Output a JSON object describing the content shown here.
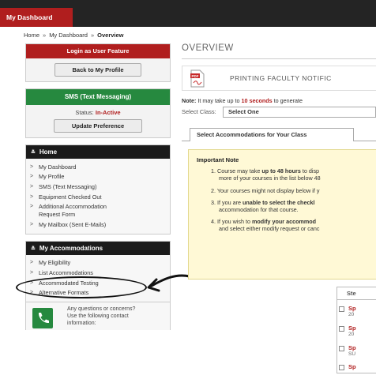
{
  "topbar": {
    "tab_label": "My Dashboard"
  },
  "breadcrumb": [
    "Home",
    "My Dashboard",
    "Overview"
  ],
  "breadcrumb_sep": "»",
  "login_box": {
    "header": "Login as User Feature",
    "button": "Back to My Profile"
  },
  "sms_box": {
    "header": "SMS (Text Messaging)",
    "status_label": "Status:",
    "status_value": "In-Active",
    "button": "Update Preference"
  },
  "home_nav": {
    "header": "Home",
    "items": [
      "My Dashboard",
      "My Profile",
      "SMS (Text Messaging)",
      "Equipment Checked Out",
      "Additional Accommodation",
      "Request Form",
      "My Mailbox (Sent E-Mails)"
    ]
  },
  "acc_nav": {
    "header": "My Accommodations",
    "items": [
      "My Eligibility",
      "List Accommodations",
      "Accommodated Testing",
      "Alternative Formats"
    ]
  },
  "contact": {
    "lines": [
      "Any questions or concerns?",
      "Use the following contact",
      "information:"
    ]
  },
  "main": {
    "title": "OVERVIEW",
    "print_text": "PRINTING FACULTY NOTIFIC",
    "note_prefix": "Note:",
    "note_pre": " It may take up to ",
    "note_bold": "10 seconds",
    "note_post": " to generate",
    "class_label": "Select Class:",
    "class_value": "Select One",
    "tab_label": "Select Accommodations for Your Class",
    "important": {
      "header": "Important Note",
      "items": [
        {
          "num": "1.",
          "l1a": "Course may take ",
          "l1b": "up to 48 hours",
          "l1c": " to disp",
          "l2": "more of your courses in the list below 48"
        },
        {
          "num": "2.",
          "l1": "Your courses might not display below if y"
        },
        {
          "num": "3.",
          "l1a": "If you are ",
          "l1b": "unable to select the checkl",
          "l2": "accommodation for that course."
        },
        {
          "num": "4.",
          "l1a": "If you wish to ",
          "l1b": "modify your accommod",
          "l2": "and select either modify request or canc"
        }
      ]
    },
    "steps": {
      "header": "Ste",
      "rows": [
        {
          "t1": "Sp",
          "t2": "20"
        },
        {
          "t1": "Sp",
          "t2": "20"
        },
        {
          "t1": "Sp",
          "t2": "SU"
        },
        {
          "t1": "Sp",
          "t2": ""
        }
      ]
    }
  }
}
